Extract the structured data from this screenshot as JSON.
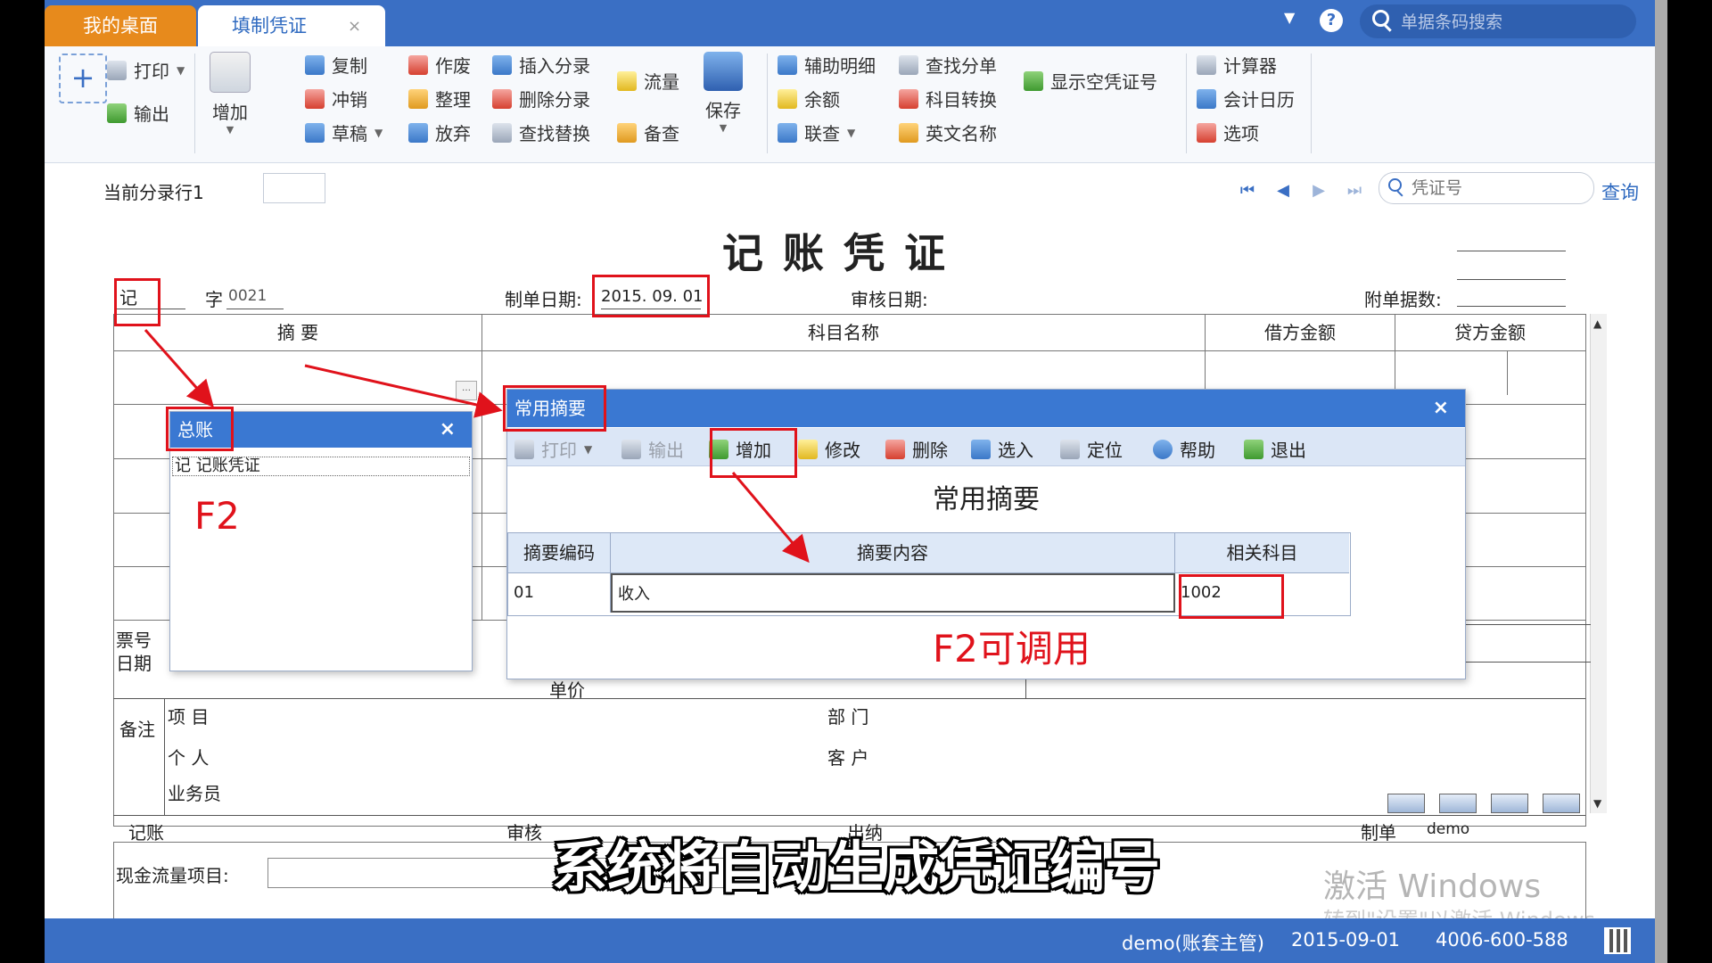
{
  "tabs": {
    "home": "我的桌面",
    "active": "填制凭证",
    "close": "×"
  },
  "top_search": {
    "placeholder": "单据条码搜索"
  },
  "ribbon": {
    "print": "打印",
    "export": "输出",
    "add": "增加",
    "copy": "复制",
    "reverse": "冲销",
    "draft": "草稿",
    "void": "作废",
    "tidy": "整理",
    "discard": "放弃",
    "insert_entry": "插入分录",
    "delete_entry": "删除分录",
    "find_replace": "查找替换",
    "cashflow": "流量",
    "memo": "备查",
    "save": "保存",
    "aux_detail": "辅助明细",
    "balance": "余额",
    "link_query": "联查",
    "find_split": "查找分单",
    "subject_convert": "科目转换",
    "english_name": "英文名称",
    "show_empty": "显示空凭证号",
    "calculator": "计算器",
    "calendar": "会计日历",
    "options": "选项"
  },
  "rowbar": {
    "label": "当前分录行1",
    "voucher_search_placeholder": "凭证号",
    "query": "查询"
  },
  "voucher": {
    "title": "记账凭证",
    "type": "记",
    "zi": "字",
    "number": "0021",
    "date_label": "制单日期:",
    "date": "2015. 09. 01",
    "audit_label": "审核日期:",
    "attach_label": "附单据数:",
    "headers": {
      "summary": "摘 要",
      "subject": "科目名称",
      "debit": "借方金额",
      "credit": "贷方金额"
    },
    "ticket": "票号",
    "ticket_date": "日期",
    "unit_price": "单价",
    "remark": "备注",
    "project": "项 目",
    "dept": "部 门",
    "person": "个 人",
    "customer": "客 户",
    "salesman": "业务员",
    "bookkeep": "记账",
    "auditor": "审核",
    "cashier": "出纳",
    "maker": "制单",
    "maker_name": "demo",
    "cashflow_label": "现金流量项目:"
  },
  "popup_gl": {
    "title": "总账",
    "close": "×",
    "item": "记  记账凭证"
  },
  "popup_common": {
    "title": "常用摘要",
    "close": "×",
    "tools": {
      "print": "打印",
      "export": "输出",
      "add": "增加",
      "edit": "修改",
      "delete": "删除",
      "select": "选入",
      "locate": "定位",
      "help": "帮助",
      "exit": "退出"
    },
    "heading": "常用摘要",
    "columns": [
      "摘要编码",
      "摘要内容",
      "相关科目"
    ],
    "rows": [
      {
        "code": "01",
        "content": "收入",
        "subject": "1002"
      }
    ]
  },
  "annotations": {
    "f2": "F2",
    "f2_callable": "F2可调用"
  },
  "subtitle": "系统将自动生成凭证编号",
  "watermark": {
    "line1": "激活 Windows",
    "line2": "转到\"设置\"以激活 Windows。"
  },
  "status": {
    "user": "demo(账套主管)",
    "date": "2015-09-01",
    "phone": "4006-600-588"
  },
  "colors": {
    "accent": "#3a6fc4",
    "tab_home": "#e78a1c",
    "annotation": "#e0121b"
  }
}
